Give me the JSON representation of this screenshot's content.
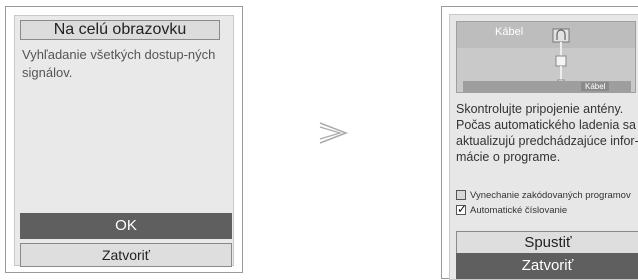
{
  "left_dialog": {
    "title": "Na celú obrazovku",
    "description": "Vyhľadanie všetkých dostup-ných signálov.",
    "ok_label": "OK",
    "close_label": "Zatvoriť"
  },
  "right_dialog": {
    "graphic": {
      "label_top": "Kábel",
      "label_bottom": "Kábel"
    },
    "description": "Skontrolujte pripojenie antény. Počas automatického ladenia sa aktualizujú predchádzajúce infor-mácie o programe.",
    "options": [
      {
        "label": "Vynechanie zakódovaných programov",
        "checked": false
      },
      {
        "label": "Automatické číslovanie",
        "checked": true
      }
    ],
    "start_label": "Spustiť",
    "close_label": "Zatvoriť"
  },
  "colors": {
    "dark_button": "#5f5f5f",
    "light_button": "#dedede",
    "panel": "#e9e9e9"
  }
}
